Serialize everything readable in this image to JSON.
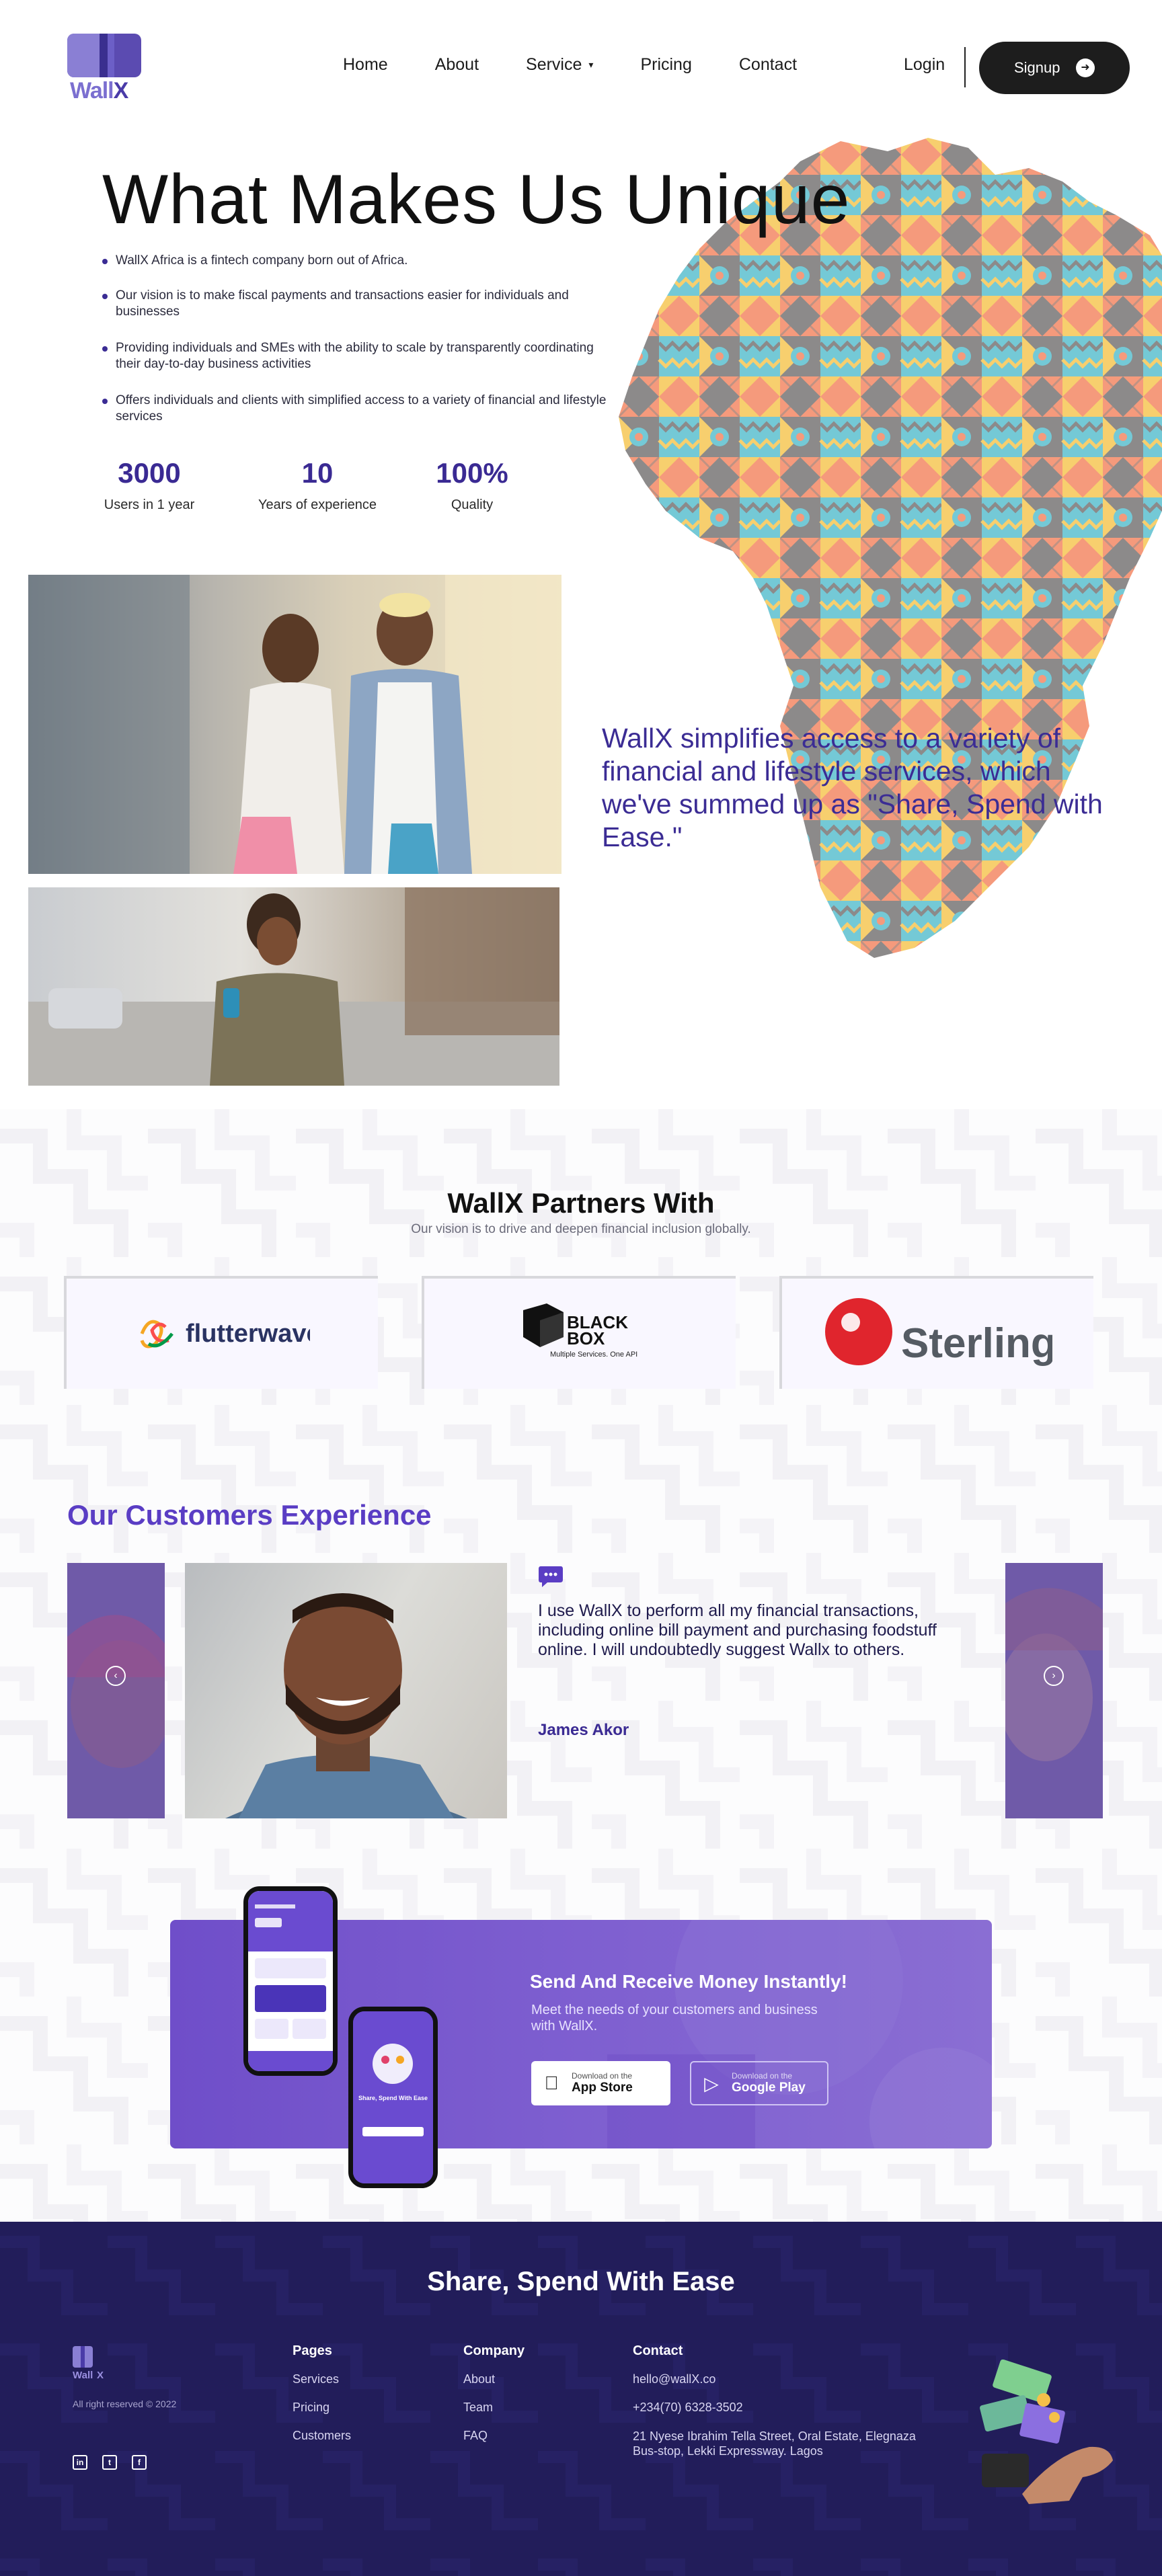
{
  "brand": {
    "name_light": "Wall",
    "name_bold": "X"
  },
  "nav": {
    "items": [
      "Home",
      "About",
      "Service",
      "Pricing",
      "Contact"
    ],
    "login": "Login",
    "signup": "Signup"
  },
  "hero": {
    "title": "What Makes Us Unique",
    "bullets": [
      "WallX Africa is a fintech company born out of Africa.",
      "Our vision is to make fiscal payments and transactions easier for individuals and businesses",
      "Providing individuals and SMEs with the ability to scale by transparently coordinating their day-to-day business activities",
      "Offers individuals and clients with simplified access to a variety of financial and lifestyle services"
    ],
    "stats": [
      {
        "value": "3000",
        "label": "Users in 1 year"
      },
      {
        "value": "10",
        "label": "Years of experience"
      },
      {
        "value": "100%",
        "label": "Quality"
      }
    ]
  },
  "simplify_text": "WallX simplifies access to a variety of financial and lifestyle services, which we've summed up as \"Share, Spend with Ease.\"",
  "partners": {
    "title": "WallX Partners With",
    "subtitle": "Our vision is to drive and deepen financial inclusion globally.",
    "logos": [
      {
        "name": "flutterwave"
      },
      {
        "name": "BLACK BOX",
        "line1": "BLACK",
        "line2": "BOX",
        "tagline": "Multiple Services. One API"
      },
      {
        "name": "Sterling"
      }
    ]
  },
  "customers": {
    "title": "Our Customers Experience",
    "quote": "I use WallX to perform all my financial transactions, including online bill payment and purchasing foodstuff online. I will undoubtedly suggest Wallx to others.",
    "name": "James Akor"
  },
  "app_banner": {
    "title": "Send And Receive Money Instantly!",
    "subtitle": "Meet the needs of your customers and business with WallX.",
    "appstore": {
      "small": "Download on the",
      "big": "App Store"
    },
    "googleplay": {
      "small": "Download on the",
      "big": "Google Play"
    },
    "phone_text": "Share, Spend With Ease"
  },
  "footer": {
    "title": "Share, Spend With Ease",
    "rights": "All right reserved © 2022",
    "pages": {
      "heading": "Pages",
      "links": [
        "Services",
        "Pricing",
        "Customers"
      ]
    },
    "company": {
      "heading": "Company",
      "links": [
        "About",
        "Team",
        "FAQ"
      ]
    },
    "contact": {
      "heading": "Contact",
      "email": "hello@wallX.co",
      "phone": "+234(70) 6328-3502",
      "address": "21 Nyese Ibrahim Tella Street, Oral Estate, Elegnaza Bus-stop, Lekki Expressway. Lagos"
    }
  },
  "colors": {
    "primary": "#3b2c94",
    "accent_purple": "#5a3dc4",
    "footer_bg": "#221d5a",
    "banner_bg": "#7e5fd0",
    "signup_bg": "#1d1d1d"
  }
}
